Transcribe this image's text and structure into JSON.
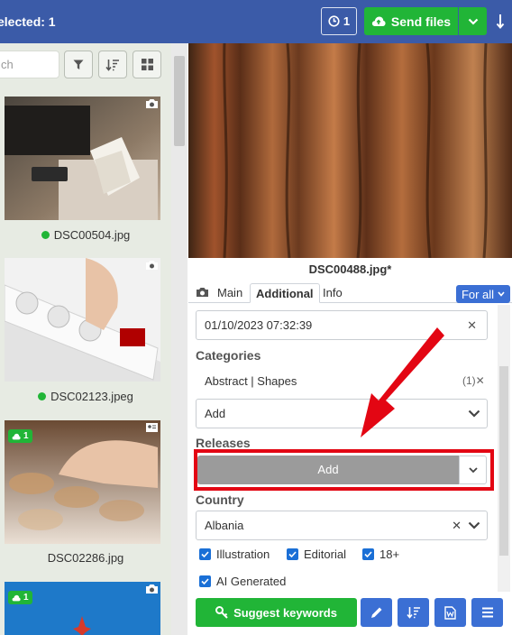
{
  "topbar": {
    "selected_text": "elected: 1",
    "history_count": "1",
    "send_label": "Send files"
  },
  "left": {
    "search_placeholder": "ch",
    "thumbnails": [
      {
        "filename": "DSC00504.jpg",
        "status": "green-dot"
      },
      {
        "filename": "DSC02123.jpeg",
        "status": "green-dot"
      },
      {
        "filename": "DSC02286.jpg",
        "badge": "1"
      },
      {
        "filename": "",
        "badge": "1"
      }
    ]
  },
  "preview": {
    "filename": "DSC00488.jpg*"
  },
  "tabs": {
    "items": [
      "Main",
      "Additional",
      "Info"
    ],
    "active": "Additional",
    "for_all_label": "For all"
  },
  "form": {
    "date_value": "01/10/2023 07:32:39",
    "categories_label": "Categories",
    "category_item": "Abstract | Shapes",
    "category_count": "(1)",
    "category_add": "Add",
    "releases_label": "Releases",
    "release_add": "Add",
    "country_label": "Country",
    "country_value": "Albania",
    "checkboxes": [
      "Illustration",
      "Editorial",
      "18+",
      "AI Generated"
    ]
  },
  "bottom": {
    "suggest_label": "Suggest keywords"
  },
  "colors": {
    "topbar": "#3b5ba8",
    "green": "#21b537",
    "blue_button": "#3b6fd4",
    "highlight_red": "#e30613"
  }
}
